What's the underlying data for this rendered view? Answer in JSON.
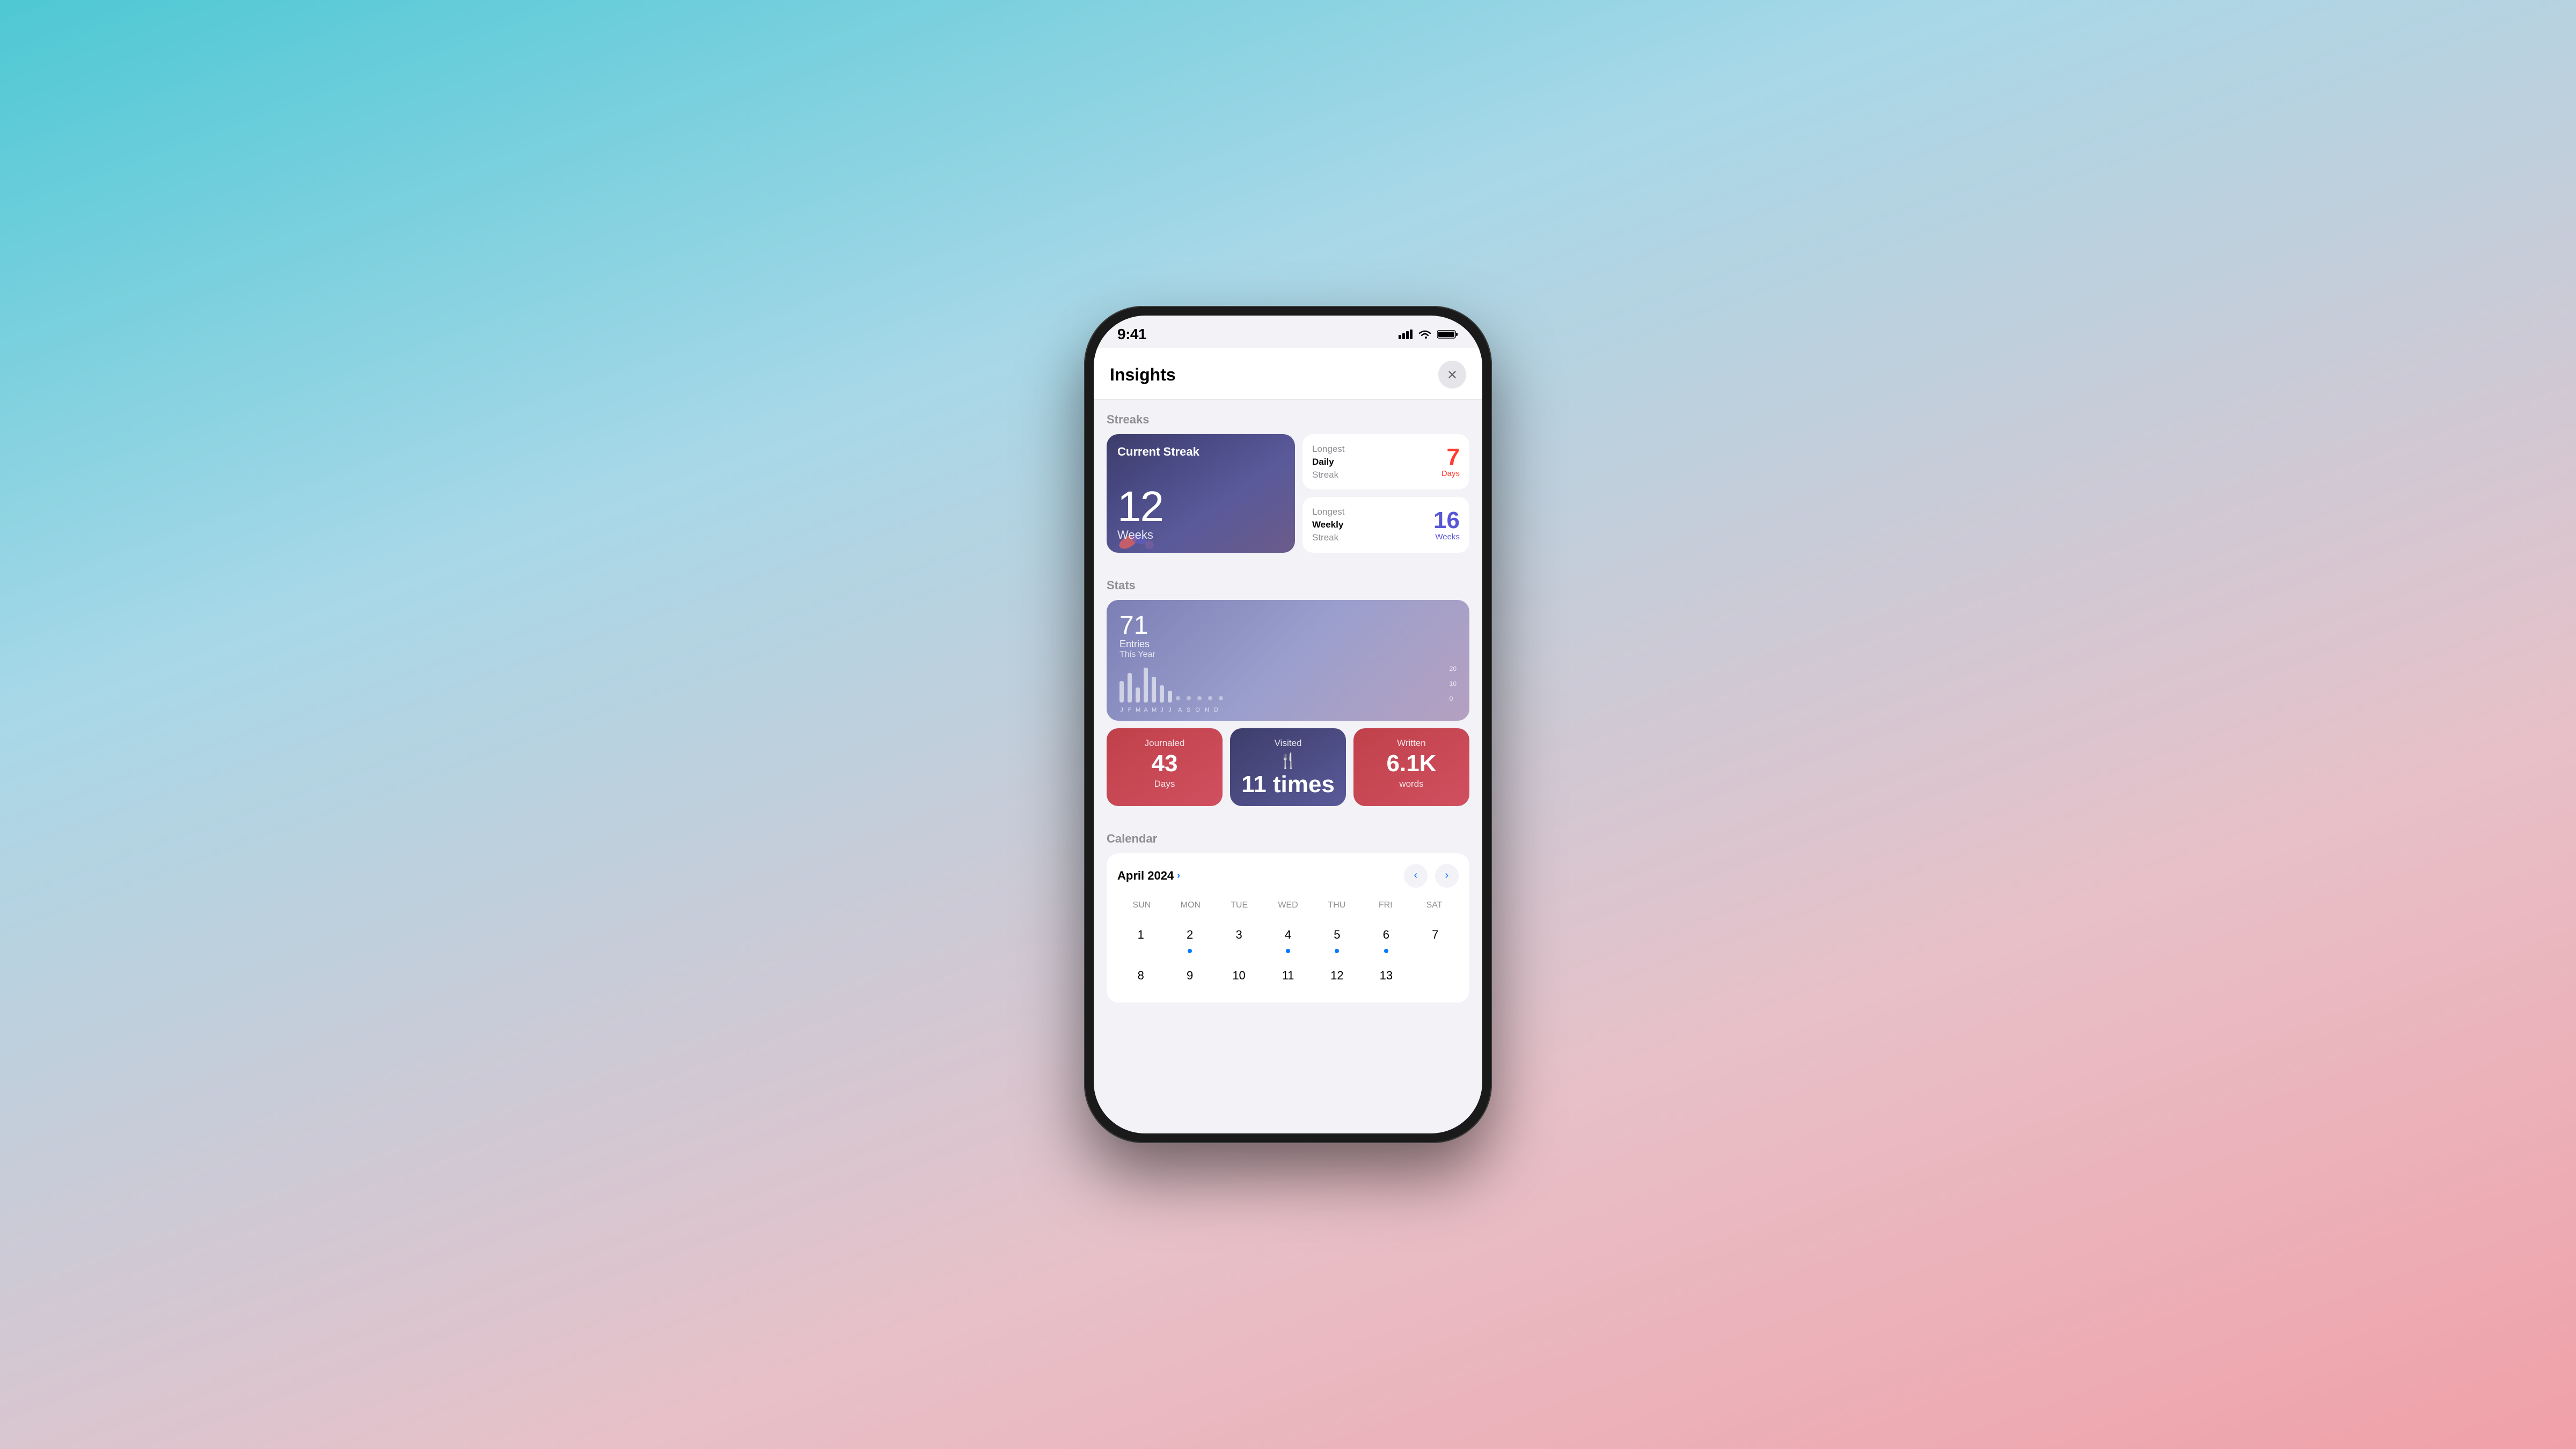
{
  "status_bar": {
    "time": "9:41"
  },
  "modal": {
    "title": "Insights",
    "close_label": "✕"
  },
  "streaks": {
    "section_title": "Streaks",
    "current": {
      "label": "Current Streak",
      "number": "12",
      "unit": "Weeks"
    },
    "longest_daily": {
      "label_top": "Longest",
      "label_mid": "Daily",
      "label_bot": "Streak",
      "number": "7",
      "unit": "Days"
    },
    "longest_weekly": {
      "label_top": "Longest",
      "label_mid": "Weekly",
      "label_bot": "Streak",
      "number": "16",
      "unit": "Weeks"
    }
  },
  "stats": {
    "section_title": "Stats",
    "entries": {
      "number": "71",
      "label": "Entries",
      "sublabel": "This Year"
    },
    "chart": {
      "y_max": "20",
      "y_mid": "10",
      "y_min": "0",
      "months": [
        "J",
        "F",
        "M",
        "A",
        "M",
        "J",
        "J",
        "A",
        "S",
        "O",
        "N",
        "D"
      ],
      "bars": [
        {
          "height": 40,
          "type": "bar"
        },
        {
          "height": 55,
          "type": "bar"
        },
        {
          "height": 30,
          "type": "bar"
        },
        {
          "height": 65,
          "type": "bar"
        },
        {
          "height": 50,
          "type": "bar"
        },
        {
          "height": 35,
          "type": "bar"
        },
        {
          "height": 25,
          "type": "bar"
        },
        {
          "height": 5,
          "type": "dot"
        },
        {
          "height": 5,
          "type": "dot"
        },
        {
          "height": 5,
          "type": "dot"
        },
        {
          "height": 5,
          "type": "dot"
        },
        {
          "height": 5,
          "type": "dot"
        }
      ]
    },
    "tiles": [
      {
        "id": "journaled",
        "label": "Journaled",
        "number": "43",
        "unit": "Days",
        "icon": null
      },
      {
        "id": "visited",
        "label": "Visited",
        "number": "11 times",
        "unit": null,
        "icon": "🍴"
      },
      {
        "id": "written",
        "label": "Written",
        "number": "6.1K",
        "unit": "words",
        "icon": null
      }
    ]
  },
  "calendar": {
    "section_title": "Calendar",
    "month": "April 2024",
    "weekdays": [
      "SUN",
      "MON",
      "TUE",
      "WED",
      "THU",
      "FRI",
      "SAT"
    ],
    "days": [
      {
        "number": "1",
        "dot": false
      },
      {
        "number": "2",
        "dot": true
      },
      {
        "number": "3",
        "dot": false
      },
      {
        "number": "4",
        "dot": true
      },
      {
        "number": "5",
        "dot": true
      },
      {
        "number": "6",
        "dot": true
      },
      {
        "number": "7",
        "dot": false
      },
      {
        "number": "8",
        "dot": false
      },
      {
        "number": "9",
        "dot": false
      },
      {
        "number": "10",
        "dot": false
      },
      {
        "number": "11",
        "dot": false
      },
      {
        "number": "12",
        "dot": false
      }
    ],
    "prev_label": "‹",
    "next_label": "›"
  }
}
